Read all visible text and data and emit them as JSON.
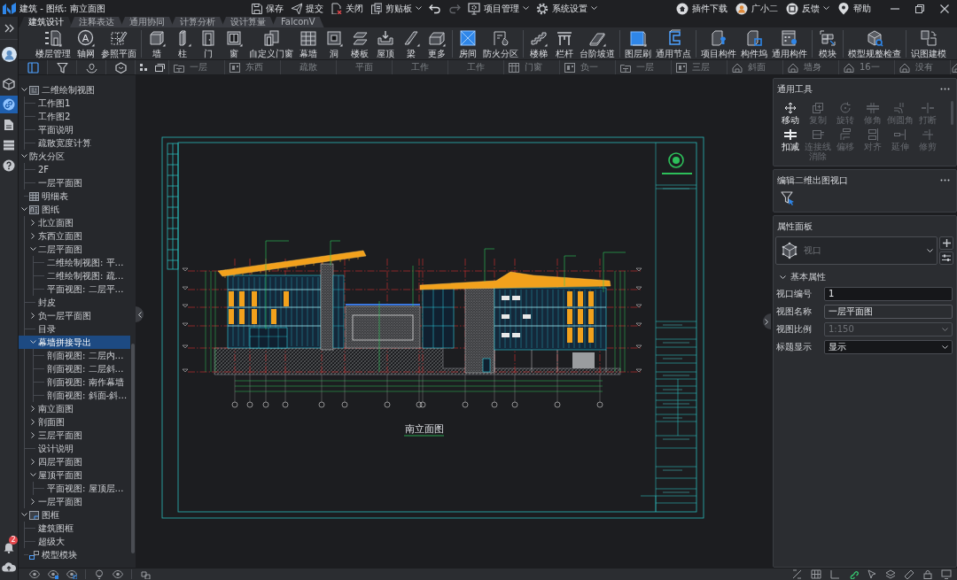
{
  "window": {
    "title": "建筑 - 图纸: 南立面图"
  },
  "quick_actions": [
    {
      "label": "保存",
      "dropdown": false
    },
    {
      "label": "提交",
      "dropdown": false
    },
    {
      "label": "关闭",
      "dropdown": false
    },
    {
      "label": "剪贴板",
      "dropdown": true
    }
  ],
  "history": [
    {
      "disabled": false
    },
    {
      "disabled": true
    }
  ],
  "menus": [
    {
      "label": "项目管理",
      "dropdown": true
    },
    {
      "label": "系统设置",
      "dropdown": true
    }
  ],
  "account": [
    {
      "label": "插件下载",
      "dropdown": false
    },
    {
      "label": "广小二",
      "dropdown": false
    },
    {
      "label": "反馈",
      "dropdown": true
    },
    {
      "label": "帮助",
      "dropdown": false
    }
  ],
  "sidebar": {
    "nav": [
      {
        "selected": false
      },
      {
        "selected": true
      },
      {
        "selected": false
      },
      {
        "selected": false
      },
      {
        "selected": false
      }
    ],
    "notification_count": "2"
  },
  "ribbon_tabs": [
    {
      "label": "建筑设计",
      "selected": true
    },
    {
      "label": "注释表达",
      "selected": false
    },
    {
      "label": "通用协同",
      "selected": false
    },
    {
      "label": "计算分析",
      "selected": false
    },
    {
      "label": "设计算量",
      "selected": false
    },
    {
      "label": "FalconV",
      "selected": false
    }
  ],
  "ribbon": [
    [
      {
        "label": "楼层管理",
        "dropdown": true
      },
      {
        "label": "轴网",
        "glyph": "A",
        "dropdown": true
      },
      {
        "label": "参照平面",
        "dropdown": false
      }
    ],
    [
      {
        "label": "墙",
        "dropdown": true
      },
      {
        "label": "柱",
        "dropdown": true
      },
      {
        "label": "门",
        "dropdown": false
      },
      {
        "label": "窗",
        "dropdown": true
      },
      {
        "label": "自定义门窗",
        "dropdown": false
      },
      {
        "label": "幕墙",
        "dropdown": false
      },
      {
        "label": "洞",
        "dropdown": true
      },
      {
        "label": "楼板",
        "dropdown": false
      },
      {
        "label": "屋顶",
        "dropdown": false
      },
      {
        "label": "梁",
        "dropdown": true
      },
      {
        "label": "更多",
        "dropdown": true
      }
    ],
    [
      {
        "label": "房间",
        "dropdown": false
      },
      {
        "label": "防火分区",
        "dropdown": false
      }
    ],
    [
      {
        "label": "楼梯",
        "dropdown": true
      },
      {
        "label": "栏杆",
        "dropdown": false
      },
      {
        "label": "台阶坡道",
        "dropdown": true
      }
    ],
    [
      {
        "label": "图层刷",
        "dropdown": true
      },
      {
        "label": "通用节点",
        "dropdown": false
      }
    ],
    [
      {
        "label": "项目构件",
        "dropdown": false
      },
      {
        "label": "构件坞",
        "dropdown": false
      },
      {
        "label": "通用构件",
        "dropdown": false
      }
    ],
    [
      {
        "label": "模块",
        "dropdown": false
      }
    ],
    [
      {
        "label": "模型规整检查",
        "dropdown": false
      }
    ],
    [
      {
        "label": "识图建模",
        "dropdown": false
      }
    ]
  ],
  "panel_tabs": [
    {
      "selected": true
    },
    {
      "selected": false
    },
    {
      "selected": false
    },
    {
      "selected": false
    }
  ],
  "view_tabs": [
    {
      "kind": "plan",
      "label": "一层",
      "selected": false
    },
    {
      "kind": "elevation",
      "label": "东西",
      "selected": false
    },
    {
      "kind": "drafting",
      "label": "疏散",
      "selected": false
    },
    {
      "kind": "drafting",
      "label": "平面",
      "selected": false
    },
    {
      "kind": "drafting",
      "label": "工作",
      "selected": false
    },
    {
      "kind": "drafting",
      "label": "工作",
      "selected": false
    },
    {
      "kind": "schedule",
      "label": "门窗",
      "selected": false
    },
    {
      "kind": "elevation",
      "label": "负一",
      "selected": false
    },
    {
      "kind": "plan",
      "label": "一层",
      "selected": false
    },
    {
      "kind": "elevation",
      "label": "三层",
      "selected": false
    },
    {
      "kind": "perspective",
      "label": "斜面",
      "selected": false
    },
    {
      "kind": "perspective",
      "label": "墙身",
      "selected": false
    },
    {
      "kind": "perspective",
      "label": "16一",
      "selected": false
    },
    {
      "kind": "perspective",
      "label": "没有",
      "selected": false
    },
    {
      "kind": "perspective",
      "selected": false
    }
  ],
  "tree": [
    {
      "label": "二维绘制视图",
      "kind": "views",
      "expanded": true,
      "selected": false,
      "children": [
        {
          "label": "工作图1",
          "selected": false
        },
        {
          "label": "工作图2",
          "selected": false
        },
        {
          "label": "平面说明",
          "selected": false
        },
        {
          "label": "疏散宽度计算",
          "selected": false
        }
      ]
    },
    {
      "label": "防火分区",
      "kind": "folder",
      "expanded": true,
      "selected": false,
      "children": [
        {
          "label": "2F",
          "selected": false
        },
        {
          "label": "一层平面图",
          "selected": false
        }
      ]
    },
    {
      "label": "明细表",
      "kind": "schedules",
      "selected": false
    },
    {
      "label": "图纸",
      "kind": "sheets",
      "expanded": true,
      "selected": false,
      "children": [
        {
          "label": "北立面图",
          "expanded": false,
          "selected": false
        },
        {
          "label": "东西立面图",
          "expanded": false,
          "selected": false
        },
        {
          "label": "二层平面图",
          "expanded": true,
          "selected": false,
          "children": [
            {
              "label": "二维绘制视图: 平…",
              "selected": false
            },
            {
              "label": "二维绘制视图: 疏…",
              "selected": false
            },
            {
              "label": "平面视图: 二层平…",
              "selected": false
            }
          ]
        },
        {
          "label": "封皮",
          "selected": false
        },
        {
          "label": "负一层平面图",
          "expanded": false,
          "selected": false
        },
        {
          "label": "目录",
          "selected": false
        },
        {
          "label": "幕墙拼接导出",
          "expanded": true,
          "selected": true,
          "children": [
            {
              "label": "剖面视图: 二层内…",
              "selected": false
            },
            {
              "label": "剖面视图: 二层斜…",
              "selected": false
            },
            {
              "label": "剖面视图: 南作幕墙",
              "selected": false
            },
            {
              "label": "剖面视图: 斜面-斜…",
              "selected": false
            }
          ]
        },
        {
          "label": "南立面图",
          "expanded": false,
          "selected": false
        },
        {
          "label": "剖面图",
          "expanded": false,
          "selected": false
        },
        {
          "label": "三层平面图",
          "expanded": false,
          "selected": false
        },
        {
          "label": "设计说明",
          "selected": false
        },
        {
          "label": "四层平面图",
          "expanded": false,
          "selected": false
        },
        {
          "label": "屋顶平面图",
          "expanded": true,
          "selected": false,
          "children": [
            {
              "label": "平面视图: 屋顶层…",
              "selected": false
            }
          ]
        },
        {
          "label": "一层平面图",
          "expanded": false,
          "selected": false
        }
      ]
    },
    {
      "label": "图框",
      "kind": "frames",
      "expanded": true,
      "selected": false,
      "children": [
        {
          "label": "建筑图框",
          "selected": false
        },
        {
          "label": "超级大",
          "selected": false
        }
      ]
    },
    {
      "label": "模型模块",
      "kind": "modules",
      "selected": false
    }
  ],
  "canvas": {
    "caption": "南立面图"
  },
  "tools": {
    "title": "通用工具",
    "items": [
      {
        "label": "移动",
        "disabled": false
      },
      {
        "label": "复制",
        "disabled": true
      },
      {
        "label": "旋转",
        "disabled": true
      },
      {
        "label": "修角",
        "disabled": true
      },
      {
        "label": "倒圆角",
        "disabled": true
      },
      {
        "label": "打断",
        "disabled": true
      },
      {
        "label": "扣减",
        "disabled": false
      },
      {
        "label": "连接线消除",
        "disabled": true
      },
      {
        "label": "偏移",
        "disabled": true
      },
      {
        "label": "对齐",
        "disabled": true
      },
      {
        "label": "延伸",
        "disabled": true
      },
      {
        "label": "修剪",
        "disabled": true
      }
    ]
  },
  "viewport_panel": {
    "title": "编辑二维出图视口"
  },
  "properties": {
    "title": "属性面板",
    "type": "视口",
    "section": {
      "title": "基本属性",
      "expanded": true
    },
    "fields": [
      {
        "label": "视口编号",
        "value": "1",
        "kind": "text",
        "readonly": false,
        "disabled": false
      },
      {
        "label": "视图名称",
        "value": "一层平面图",
        "kind": "text",
        "readonly": true,
        "disabled": false
      },
      {
        "label": "视图比例",
        "value": "1:150",
        "kind": "select",
        "readonly": false,
        "disabled": true
      },
      {
        "label": "标题显示",
        "value": "显示",
        "kind": "select",
        "readonly": false,
        "disabled": false
      }
    ]
  }
}
